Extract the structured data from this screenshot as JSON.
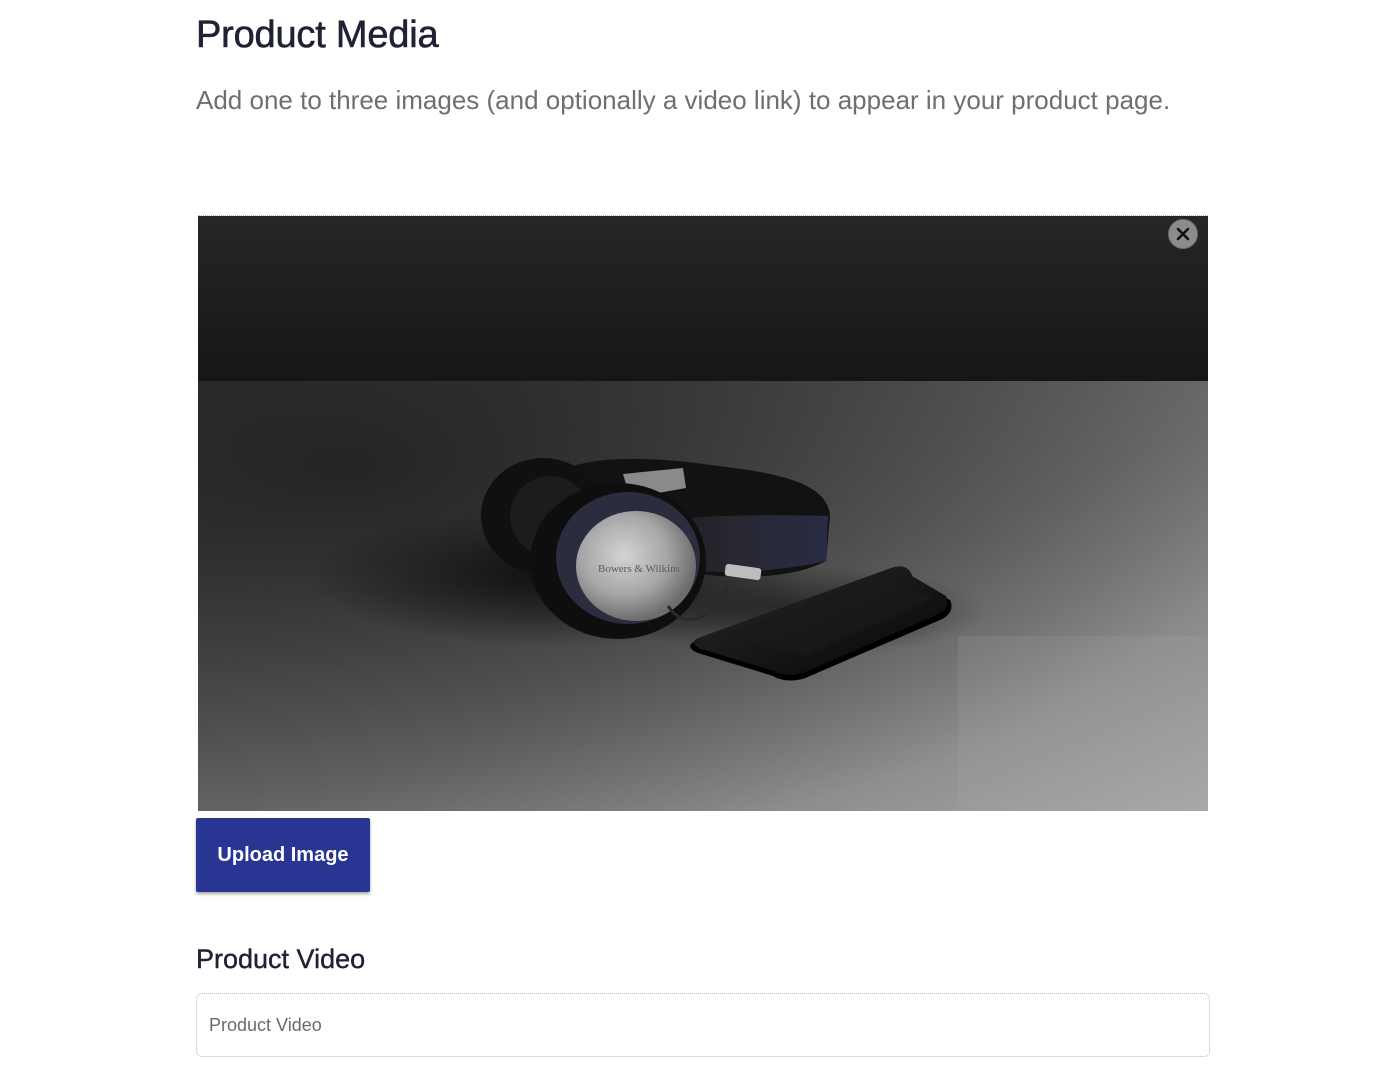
{
  "media": {
    "title": "Product Media",
    "description": "Add one to three images (and optionally a video link) to appear in your product page.",
    "uploaded_image": {
      "subject": "headphones-and-smartphone-photo",
      "brand_text": "Bowers & Wilkins"
    },
    "remove_icon": "close-icon",
    "upload_button_label": "Upload Image",
    "upload_button_color": "#283593"
  },
  "video": {
    "title": "Product Video",
    "placeholder": "Product Video",
    "value": ""
  }
}
